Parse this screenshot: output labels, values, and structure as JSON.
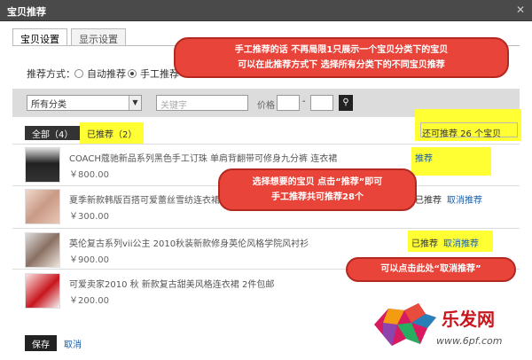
{
  "window": {
    "title": "宝贝推荐",
    "close_label": "✕"
  },
  "tabs": [
    {
      "label": "宝贝设置",
      "active": true
    },
    {
      "label": "显示设置",
      "active": false
    }
  ],
  "recommend_mode": {
    "label": "推荐方式：",
    "options": [
      {
        "label": "自动推荐",
        "selected": false
      },
      {
        "label": "手工推荐",
        "selected": true
      }
    ]
  },
  "filters": {
    "category": "所有分类",
    "keyword_placeholder": "关键字",
    "price_label": "价格",
    "dash": "-",
    "search_icon": "magnifier-icon"
  },
  "summary": {
    "all_label": "全部（4）",
    "recommended_label": "已推荐（2）",
    "recent_label": "还可推荐 26 个宝贝"
  },
  "items": [
    {
      "name": "COACH蔻驰新品系列黑色手工订珠 单肩背翻带可修身九分裤 连衣裙",
      "price": "￥800.00",
      "status": "recommend",
      "recommend_label": "推荐"
    },
    {
      "name": "夏季新款韩版百搭可爱蕾丝雪纺连衣裙荷叶边甜美 公主裙",
      "price": "￥300.00",
      "status": "recommended",
      "done_label": "已推荐",
      "cancel_label": "取消推荐"
    },
    {
      "name": "英伦复古系列vii公主 2010秋装新款修身英伦风格学院风衬衫",
      "price": "￥900.00",
      "status": "recommended",
      "done_label": "已推荐",
      "cancel_label": "取消推荐"
    },
    {
      "name": "可爱卖家2010 秋 新款复古甜美风格连衣裙 2件包邮",
      "price": "￥200.00",
      "status": "none"
    }
  ],
  "annotations": {
    "top": [
      "手工推荐的话 不再局限1只展示一个宝贝分类下的宝贝",
      "可以在此推荐方式下 选择所有分类下的不同宝贝推荐"
    ],
    "middle": [
      "选择想要的宝贝 点击“推荐”即可",
      "手工推荐共可推荐28个"
    ],
    "bottom": [
      "可以点击此处“取消推荐”"
    ]
  },
  "footer": {
    "save_label": "保存",
    "cancel_label": "取消"
  },
  "watermark": {
    "brand": "乐发网",
    "url": "www.6pf.com"
  },
  "colors": {
    "highlight": "#ffff33",
    "bubble": "#e8443a",
    "link": "#1a5ea8"
  }
}
